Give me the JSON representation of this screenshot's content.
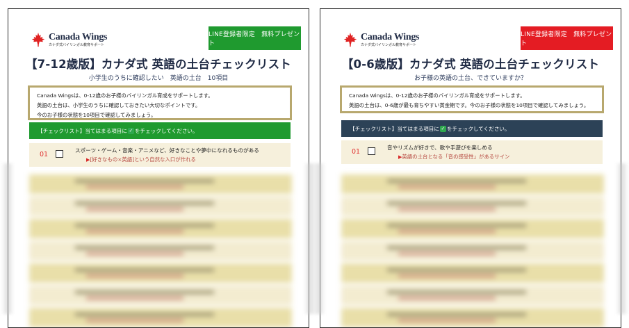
{
  "left": {
    "logo": {
      "name": "Canada Wings",
      "sub": "カナダ式バイリンガル教育サポート"
    },
    "badge": "LINE登録者限定　無料プレゼント",
    "title": "【7-12歳版】カナダ式 英語の土台チェックリスト",
    "subtitle": "小学生のうちに確認したい　英語の土台　10項目",
    "intro": [
      "Canada Wingsは、0-12歳のお子様のバイリンガル育成をサポートします。",
      "英語の土台は、小学生のうちに確認しておきたい大切なポイントです。",
      "今のお子様の状態を10項目で確認してみましょう。"
    ],
    "bar": {
      "before": "【チェックリスト】当てはまる項目に",
      "after": "をチェックしてください。"
    },
    "item": {
      "num": "01",
      "text": "スポーツ・ゲーム・音楽・アニメなど、好きなことや夢中になれるものがある",
      "sub": "[好きなもの×英語]という自然な入口が作れる"
    }
  },
  "right": {
    "logo": {
      "name": "Canada Wings",
      "sub": "カナダ式バイリンガル教育サポート"
    },
    "badge": "LINE登録者限定　無料プレゼント",
    "title": "【0-6歳版】カナダ式 英語の土台チェックリスト",
    "subtitle": "お子様の英語の土台、できていますか？",
    "intro": [
      "Canada Wingsは、0-12歳のお子様のバイリンガル育成をサポートします。",
      "英語の土台は、0-6歳が最も育ちやすい黄金期です。今のお子様の状態を10項目で確認してみましょう。"
    ],
    "bar": {
      "before": "【チェックリスト】当てはまる項目に",
      "after": "をチェックしてください。"
    },
    "item": {
      "num": "01",
      "text": "音やリズムが好きで、歌や手遊びを楽しめる",
      "sub": "英語の土台となる「音の感受性」があるサイン"
    }
  },
  "colors": {
    "green": "#1f9a2f",
    "red": "#e41c23",
    "navy": "#2c4257",
    "gold": "#b8a86e",
    "cream": "#f6f0dc"
  }
}
